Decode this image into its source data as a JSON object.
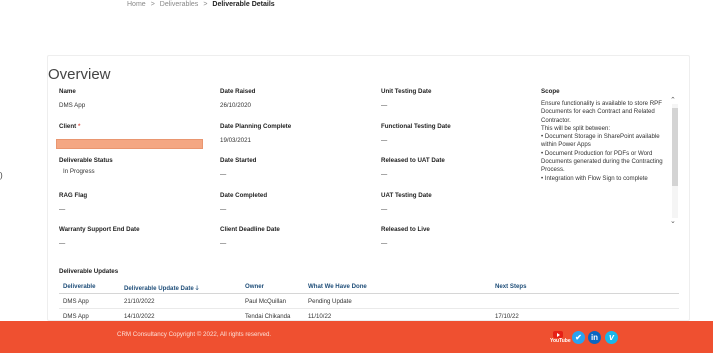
{
  "breadcrumb": {
    "home": "Home",
    "deliverables": "Deliverables",
    "current": "Deliverable Details",
    "separator": ">"
  },
  "overview": {
    "title": "Overview",
    "name_label": "Name",
    "name_value": "DMS App",
    "client_label": "Client",
    "client_required": "*",
    "status_label": "Deliverable Status",
    "status_value": "In Progress",
    "rag_label": "RAG Flag",
    "rag_value": "—",
    "warranty_label": "Warranty Support End Date",
    "warranty_value": "—",
    "date_raised_label": "Date Raised",
    "date_raised_value": "26/10/2020",
    "planning_label": "Date Planning Complete",
    "planning_value": "19/03/2021",
    "started_label": "Date Started",
    "started_value": "—",
    "completed_label": "Date Completed",
    "completed_value": "—",
    "client_deadline_label": "Client Deadline Date",
    "client_deadline_value": "—",
    "unit_testing_label": "Unit Testing Date",
    "unit_testing_value": "—",
    "functional_label": "Functional Testing Date",
    "functional_value": "—",
    "released_uat_label": "Released to UAT Date",
    "released_uat_value": "—",
    "uat_testing_label": "UAT Testing Date",
    "uat_testing_value": "—",
    "released_live_label": "Released to Live",
    "released_live_value": "—",
    "scope_label": "Scope",
    "scope_text": "Ensure functionality is available to store RPF Documents for each Contract and Related Contractor.\nThis will be split between:\n• Document Storage in SharePoint available within Power Apps\n• Document Production for PDFs or Word Documents generated during the Contracting Process.\n• Integration with Flow Sign to complete"
  },
  "updates": {
    "title": "Deliverable Updates",
    "columns": {
      "deliverable": "Deliverable",
      "update_date": "Deliverable Update Date",
      "sort_icon": "sort-down-arrow",
      "owner": "Owner",
      "what_done": "What We Have Done",
      "next_steps": "Next Steps"
    },
    "rows": [
      {
        "deliverable": "DMS App",
        "date": "21/10/2022",
        "owner": "Paul McQuillan",
        "what": "Pending Update",
        "next": ""
      },
      {
        "deliverable": "DMS App",
        "date": "14/10/2022",
        "owner": "Tendai Chikanda",
        "what": "11/10/22",
        "next": "17/10/22"
      }
    ]
  },
  "footer": {
    "copyright": "CRM Consultancy Copyright © 2022, All rights reserved.",
    "youtube_word": "YouTube"
  },
  "colors": {
    "footer": "#ef5030",
    "link_blue": "#1f4e79",
    "client_input": "#f4a783"
  }
}
